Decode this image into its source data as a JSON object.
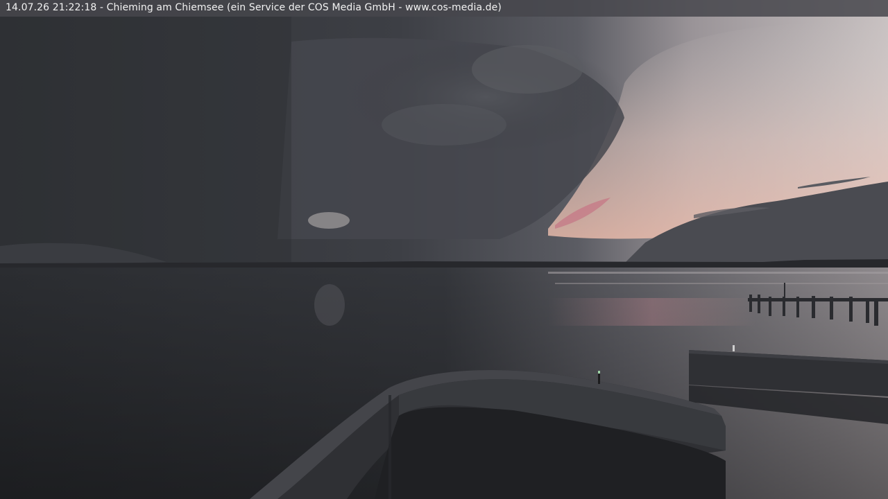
{
  "overlay": {
    "caption": "14.07.26 21:22:18 - Chieming am Chiemsee (ein Service der COS Media GmbH - www.cos-media.de)"
  }
}
